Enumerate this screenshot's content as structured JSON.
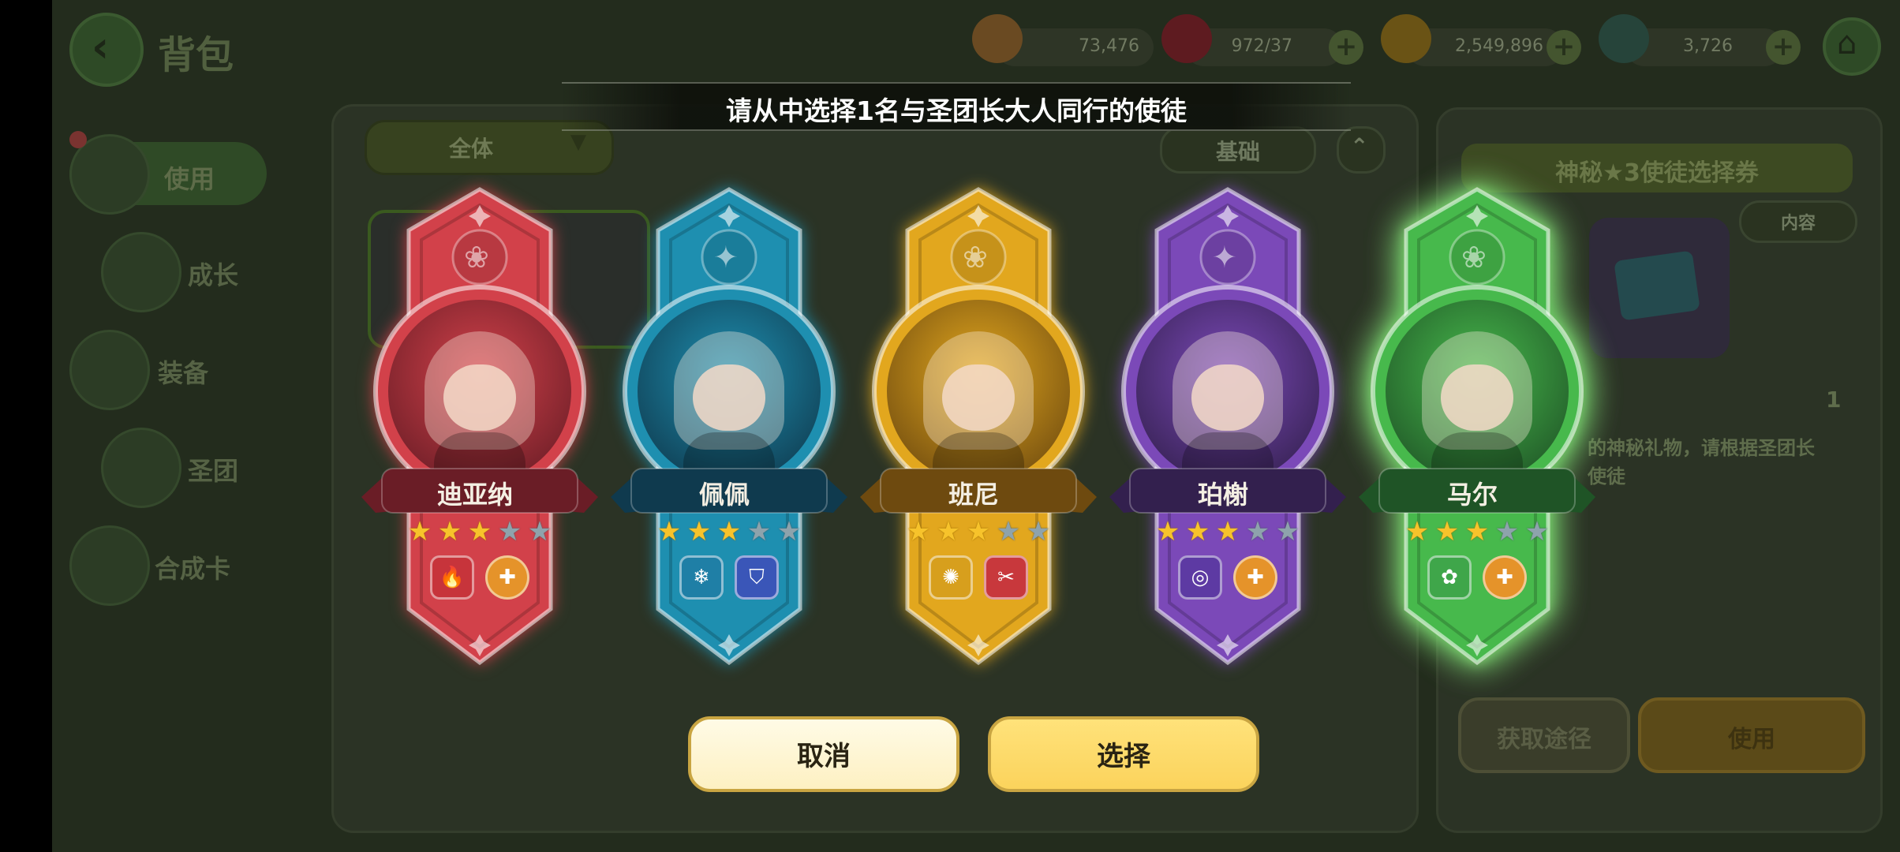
{
  "background": {
    "page_title": "背包",
    "resources": [
      {
        "name": "cookie",
        "value": "73,476",
        "color": "#9a5d25"
      },
      {
        "name": "ruby",
        "value": "972/37",
        "color": "#8a1f25"
      },
      {
        "name": "gold-coin",
        "value": "2,549,896",
        "color": "#8a6a15"
      },
      {
        "name": "leaf",
        "value": "3,726",
        "color": "#2f5a4d"
      }
    ],
    "sidebar": [
      {
        "label": "使用"
      },
      {
        "label": "成长"
      },
      {
        "label": "装备"
      },
      {
        "label": "圣团"
      },
      {
        "label": "合成卡"
      }
    ],
    "filter_all": "全体",
    "filter_basic": "基础",
    "item_title": "神秘★3使徒选择券",
    "content_tab": "内容",
    "item_count": "1",
    "item_desc_line1": "的神秘礼物，请根据圣团长",
    "item_desc_line2": "使徒",
    "get_route_button": "获取途径",
    "use_button": "使用"
  },
  "dialog": {
    "title": "请从中选择1名与圣团长大人同行的使徒",
    "cancel_label": "取消",
    "select_label": "选择"
  },
  "characters": [
    {
      "name": "迪亚纳",
      "theme": "#d2414a",
      "dark": "#6a1d26",
      "stars": 3,
      "crest": "paw",
      "badges": [
        "fire",
        "cross"
      ],
      "selected": false
    },
    {
      "name": "佩佩",
      "theme": "#1e8fb0",
      "dark": "#0f3a4e",
      "stars": 3,
      "crest": "spark",
      "badges": [
        "snowflake",
        "shield"
      ],
      "selected": false
    },
    {
      "name": "班尼",
      "theme": "#e2a71e",
      "dark": "#6e4a0f",
      "stars": 3,
      "crest": "paw",
      "badges": [
        "sun",
        "tools"
      ],
      "selected": false
    },
    {
      "name": "珀榭",
      "theme": "#7b49b8",
      "dark": "#33204e",
      "stars": 3,
      "crest": "spark",
      "badges": [
        "swirl",
        "cross"
      ],
      "selected": false
    },
    {
      "name": "马尔",
      "theme": "#47b94c",
      "dark": "#1f5426",
      "stars": 3,
      "crest": "paw",
      "badges": [
        "clover",
        "cross"
      ],
      "selected": true
    }
  ]
}
